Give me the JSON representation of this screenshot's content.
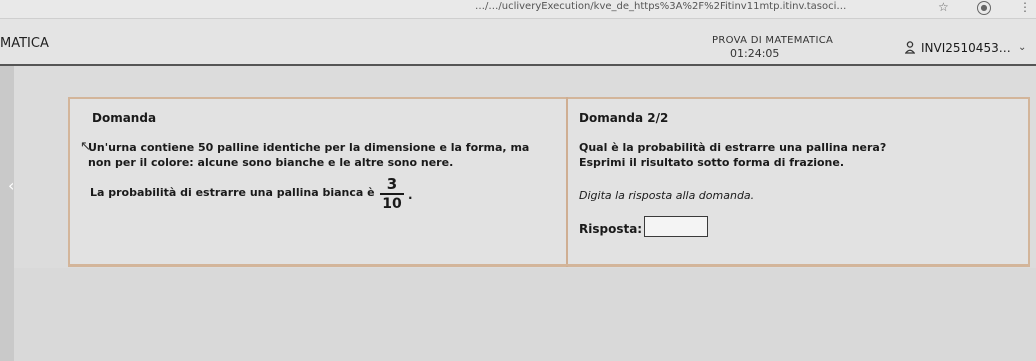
{
  "browser": {
    "url": "…/…/ucliveryExecution/kve_de_https%3A%2F%2Fitinv11mtp.itinv.tasoci…",
    "star_glyph": "☆",
    "menu_glyph": "⋮"
  },
  "header": {
    "brand": "MATICA",
    "exam_title": "PROVA DI MATEMATICA",
    "timer": "01:24:05",
    "user": "INVI2510453…"
  },
  "left": {
    "heading": "Domanda",
    "line1": "Un'urna contiene 50 palline identiche per la dimensione e la forma, ma",
    "line2": "non per il colore: alcune sono bianche e le altre sono nere.",
    "line3": "La probabilità di estrarre una pallina bianca è",
    "fraction": {
      "numerator": "3",
      "denominator": "10"
    },
    "trailing": "."
  },
  "right": {
    "heading": "Domanda 2/2",
    "line1": "Qual è la probabilità di estrarre una pallina nera?",
    "line2": "Esprimi il risultato sotto forma di frazione.",
    "instruction": "Digita la risposta alla domanda.",
    "answer_label": "Risposta:",
    "answer_value": ""
  },
  "colors": {
    "card_border": "#d3b59a",
    "header_rule": "#555555"
  }
}
